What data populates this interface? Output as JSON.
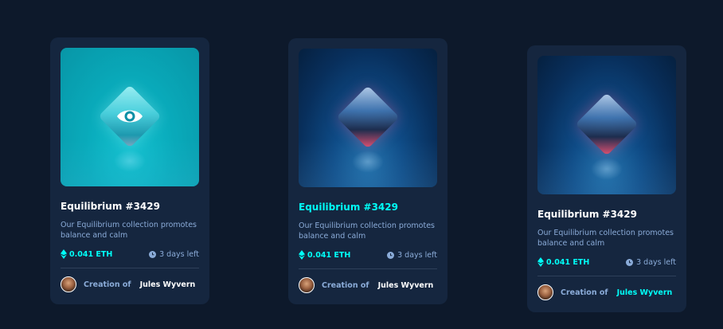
{
  "colors": {
    "background": "#0d192b",
    "card": "#15263f",
    "accent": "#00fff8",
    "muted": "#8bacd9",
    "divider": "#2e405a"
  },
  "cards": [
    {
      "state": "image-hover",
      "icon": "eye-icon",
      "title": "Equilibrium #3429",
      "description": "Our Equilibrium collection promotes balance and calm",
      "price": "0.041 ETH",
      "time_left": "3 days left",
      "creation_label": "Creation of",
      "creator": "Jules Wyvern"
    },
    {
      "state": "title-hover",
      "title": "Equilibrium #3429",
      "description": "Our Equilibrium collection promotes balance and calm",
      "price": "0.041 ETH",
      "time_left": "3 days left",
      "creation_label": "Creation of",
      "creator": "Jules Wyvern"
    },
    {
      "state": "creator-hover",
      "title": "Equilibrium #3429",
      "description": "Our Equilibrium collection promotes balance and calm",
      "price": "0.041 ETH",
      "time_left": "3 days left",
      "creation_label": "Creation of",
      "creator": "Jules Wyvern"
    }
  ]
}
